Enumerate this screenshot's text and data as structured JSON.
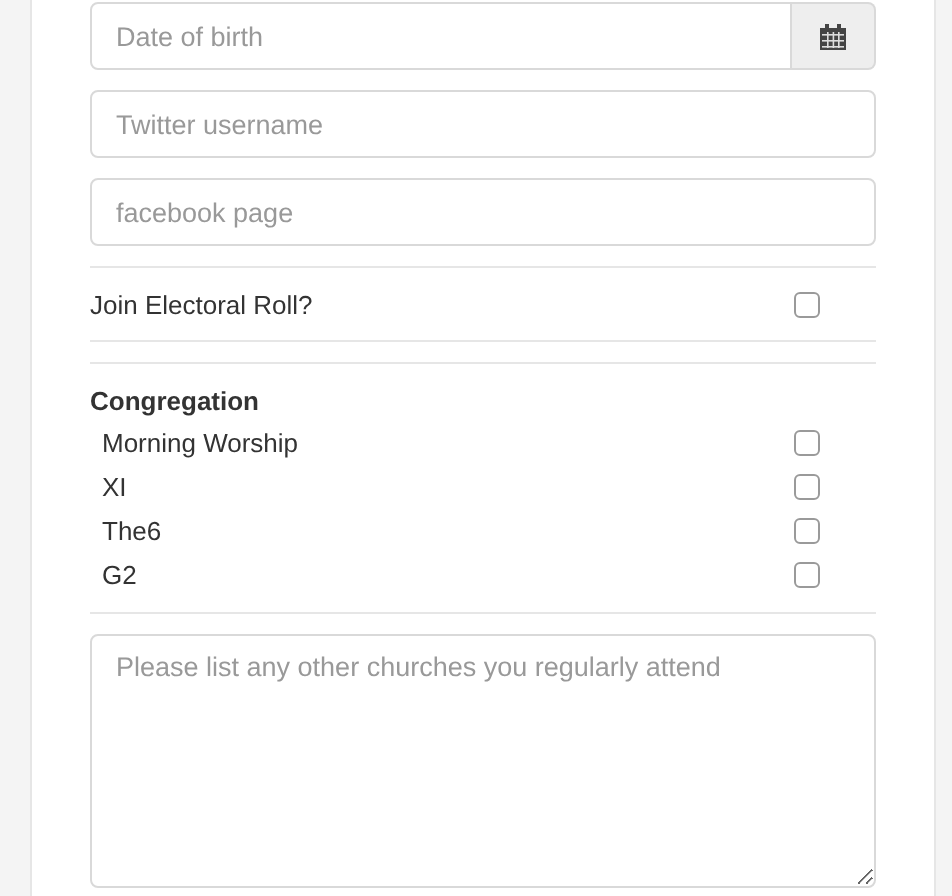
{
  "date_of_birth": {
    "placeholder": "Date of birth"
  },
  "twitter": {
    "placeholder": "Twitter username"
  },
  "facebook": {
    "placeholder": "facebook page"
  },
  "electoral_roll": {
    "label": "Join Electoral Roll?",
    "checked": false
  },
  "congregation": {
    "title": "Congregation",
    "options": [
      {
        "label": "Morning Worship",
        "checked": false
      },
      {
        "label": "XI",
        "checked": false
      },
      {
        "label": "The6",
        "checked": false
      },
      {
        "label": "G2",
        "checked": false
      }
    ]
  },
  "other_churches": {
    "placeholder": "Please list any other churches you regularly attend"
  }
}
